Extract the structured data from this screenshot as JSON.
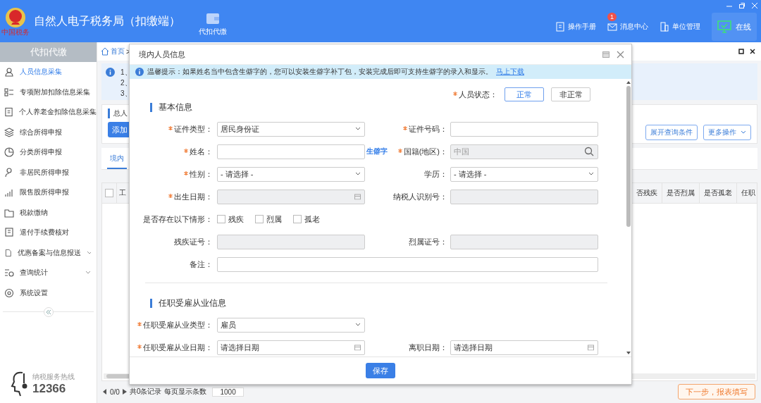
{
  "app": {
    "title": "自然人电子税务局（扣缴端）",
    "logo_caption": "中国税务"
  },
  "top_nav": [
    {
      "label": "代扣代缴",
      "selected": true
    }
  ],
  "header_links": [
    {
      "label": "操作手册"
    },
    {
      "label": "消息中心",
      "badge": "1"
    },
    {
      "label": "单位管理"
    }
  ],
  "connection": {
    "label": "在线",
    "online": true
  },
  "sidebar": {
    "title": "代扣代缴",
    "items": [
      {
        "label": "人员信息采集",
        "selected": true,
        "expandable": false
      },
      {
        "label": "专项附加扣除信息采集",
        "selected": false,
        "expandable": false
      },
      {
        "label": "个人养老金扣除信息采集",
        "selected": false,
        "expandable": false
      },
      {
        "label": "综合所得申报",
        "selected": false,
        "expandable": false
      },
      {
        "label": "分类所得申报",
        "selected": false,
        "expandable": false
      },
      {
        "label": "非居民所得申报",
        "selected": false,
        "expandable": false
      },
      {
        "label": "限售股所得申报",
        "selected": false,
        "expandable": false
      },
      {
        "label": "税款缴纳",
        "selected": false,
        "expandable": false
      },
      {
        "label": "退付手续费核对",
        "selected": false,
        "expandable": false
      },
      {
        "label": "优惠备案与信息报送",
        "selected": false,
        "expandable": true
      },
      {
        "label": "查询统计",
        "selected": false,
        "expandable": true
      },
      {
        "label": "系统设置",
        "selected": false,
        "expandable": false
      }
    ],
    "hotline": {
      "label": "纳税服务热线",
      "number": "12366"
    }
  },
  "main": {
    "breadcrumb": {
      "home": "首页",
      "separator": ">"
    },
    "notice_lines": [
      "1、",
      "2、",
      "3、"
    ],
    "summary_label": "总人",
    "add_button": "添加",
    "query_button": "展开查询条件",
    "more_button": "更多操作",
    "tabs": [
      {
        "label": "境内",
        "selected": true
      }
    ],
    "table": {
      "select_all_checked": false,
      "left_columns": [
        "工"
      ],
      "right_columns": [
        "否残疾",
        "是否烈属",
        "是否孤老",
        "任职"
      ]
    },
    "pager": {
      "position": "0/0",
      "total": "共0条记录",
      "page_size_label": "每页显示条数",
      "page_size": "1000"
    },
    "next_button": "下一步，报表填写"
  },
  "dialog": {
    "title": "境内人员信息",
    "tip": {
      "text": "温馨提示：如果姓名当中包含生僻字的，您可以安装生僻字补丁包，安装完成后即可支持生僻字的录入和显示。",
      "link": "马上下载"
    },
    "status": {
      "label": "人员状态：",
      "required": true,
      "options": [
        {
          "label": "正常",
          "selected": true
        },
        {
          "label": "非正常",
          "selected": false
        }
      ]
    },
    "sections": [
      {
        "title": "基本信息",
        "rows": [
          [
            {
              "label": "证件类型：",
              "required": true,
              "kind": "select",
              "value": "居民身份证",
              "disabled": false
            },
            {
              "label": "证件号码：",
              "required": true,
              "kind": "text",
              "disabled": false
            }
          ],
          [
            {
              "label": "姓名：",
              "required": true,
              "kind": "text",
              "disabled": false,
              "link": "生僻字"
            },
            {
              "label": "国籍(地区)：",
              "required": true,
              "kind": "search",
              "value": "中国",
              "disabled": true
            }
          ],
          [
            {
              "label": "性别：",
              "required": true,
              "kind": "select",
              "placeholder": "- 请选择 -",
              "disabled": false
            },
            {
              "label": "学历：",
              "required": false,
              "kind": "select",
              "placeholder": "- 请选择 -",
              "disabled": false
            }
          ],
          [
            {
              "label": "出生日期：",
              "required": true,
              "kind": "date",
              "disabled": true
            },
            {
              "label": "纳税人识别号：",
              "required": false,
              "kind": "text",
              "disabled": true
            }
          ],
          [
            {
              "label": "是否存在以下情形：",
              "required": false,
              "kind": "checks",
              "options": [
                {
                  "label": "残疾",
                  "checked": false
                },
                {
                  "label": "烈属",
                  "checked": false
                },
                {
                  "label": "孤老",
                  "checked": false
                }
              ]
            }
          ],
          [
            {
              "label": "残疾证号：",
              "required": false,
              "kind": "text",
              "disabled": true
            },
            {
              "label": "烈属证号：",
              "required": false,
              "kind": "text",
              "disabled": true
            }
          ],
          [
            {
              "label": "备注：",
              "required": false,
              "kind": "wide",
              "disabled": false
            }
          ]
        ]
      },
      {
        "title": "任职受雇从业信息",
        "rows": [
          [
            {
              "label": "任职受雇从业类型：",
              "required": true,
              "kind": "select",
              "value": "雇员",
              "disabled": false
            }
          ],
          [
            {
              "label": "任职受雇从业日期：",
              "required": true,
              "kind": "date",
              "placeholder": "请选择日期",
              "disabled": false
            },
            {
              "label": "离职日期：",
              "required": false,
              "kind": "date",
              "placeholder": "请选择日期",
              "disabled": false
            }
          ]
        ]
      }
    ],
    "save_button": "保存"
  }
}
